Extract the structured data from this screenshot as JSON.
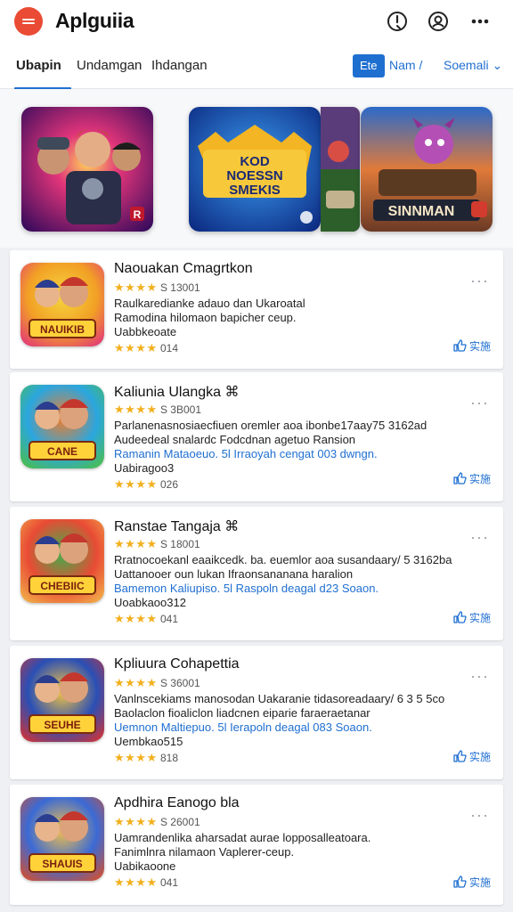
{
  "header": {
    "title": "Aplguiia",
    "icons": [
      "menu-icon",
      "info-icon",
      "account-icon",
      "more-icon"
    ]
  },
  "tabs": {
    "items": [
      {
        "label": "Ubapin",
        "active": true
      },
      {
        "label": "Undamgan"
      },
      {
        "label": "Ihdangan"
      }
    ],
    "button_label": "Ete",
    "link1_label": "Nam /",
    "link2_label": "Soemali ⌄"
  },
  "featured": {
    "tiles": [
      {
        "text": "R"
      },
      {
        "text": "KOD NOESSN SMEKIS"
      },
      {
        "text": "SINNMAN"
      }
    ]
  },
  "apps": [
    {
      "title": "Naouakan Cmagrtkon",
      "rating_text": "S 13001",
      "lines": [
        "Raulkaredianke adauo dan Ukaroatal",
        "Ramodina hilomaon bapicher ceup.",
        "Uabbkeoate"
      ],
      "blue_line_index": -1,
      "count_text": "014",
      "add_label": "实施",
      "icon_text": "NAUIKIB"
    },
    {
      "title": "Kaliunia Ulangka ⌘",
      "rating_text": "S 3B001",
      "lines": [
        "Parlanenasnosiaecfiuen oremler aoa ibonbe17aay75 3162ad",
        "Audeedeal snalardc Fodcdnan agetuo Ransion",
        "Ramanin Mataoeuo. 5l Irraoyah cengat 003 dwngn.",
        "Uabiragoo3"
      ],
      "blue_line_index": 2,
      "count_text": "026",
      "add_label": "实施",
      "icon_text": "CANE"
    },
    {
      "title": "Ranstae Tangaja ⌘",
      "rating_text": "S 18001",
      "lines": [
        "Rratnocoekanl eaaikcedk. ba. euemlor aoa susandaary/ 5 3162ba",
        "Uattanooer oun lukan Ifraonsananana haralion",
        "Bamemon Kaliupiso. 5l Raspoln deagal d23 Soaon.",
        "Uoabkaoo312"
      ],
      "blue_line_index": 2,
      "count_text": "041",
      "add_label": "实施",
      "icon_text": "CHEBIIC"
    },
    {
      "title": "Kpliuura Cohapettia",
      "rating_text": "S 36001",
      "lines": [
        "Vanlnscekiams manosodan Uakaranie tidasoreadaary/ 6 3 5 5co",
        "Baolaclon fioaliclon liadcnen eiparie faraeraetanar",
        "Uemnon Maltiepuo. 5l Ierapoln deagal 083 Soaon.",
        "Uembkao515"
      ],
      "blue_line_index": 2,
      "count_text": "818",
      "add_label": "实施",
      "icon_text": "SEUHE"
    },
    {
      "title": "Apdhira Eanogo bla",
      "rating_text": "S 26001",
      "lines": [
        "Uamrandenlika aharsadat aurae lopposalleatoara.",
        "Fanimlnra nilamaon Vaplerer-ceup.",
        "Uabikaoone"
      ],
      "blue_line_index": -1,
      "count_text": "041",
      "add_label": "实施",
      "icon_text": "SHAUIS"
    }
  ],
  "colors": {
    "accent": "#1f6fd1",
    "menu": "#ea4b35",
    "star": "#f2b01e"
  }
}
